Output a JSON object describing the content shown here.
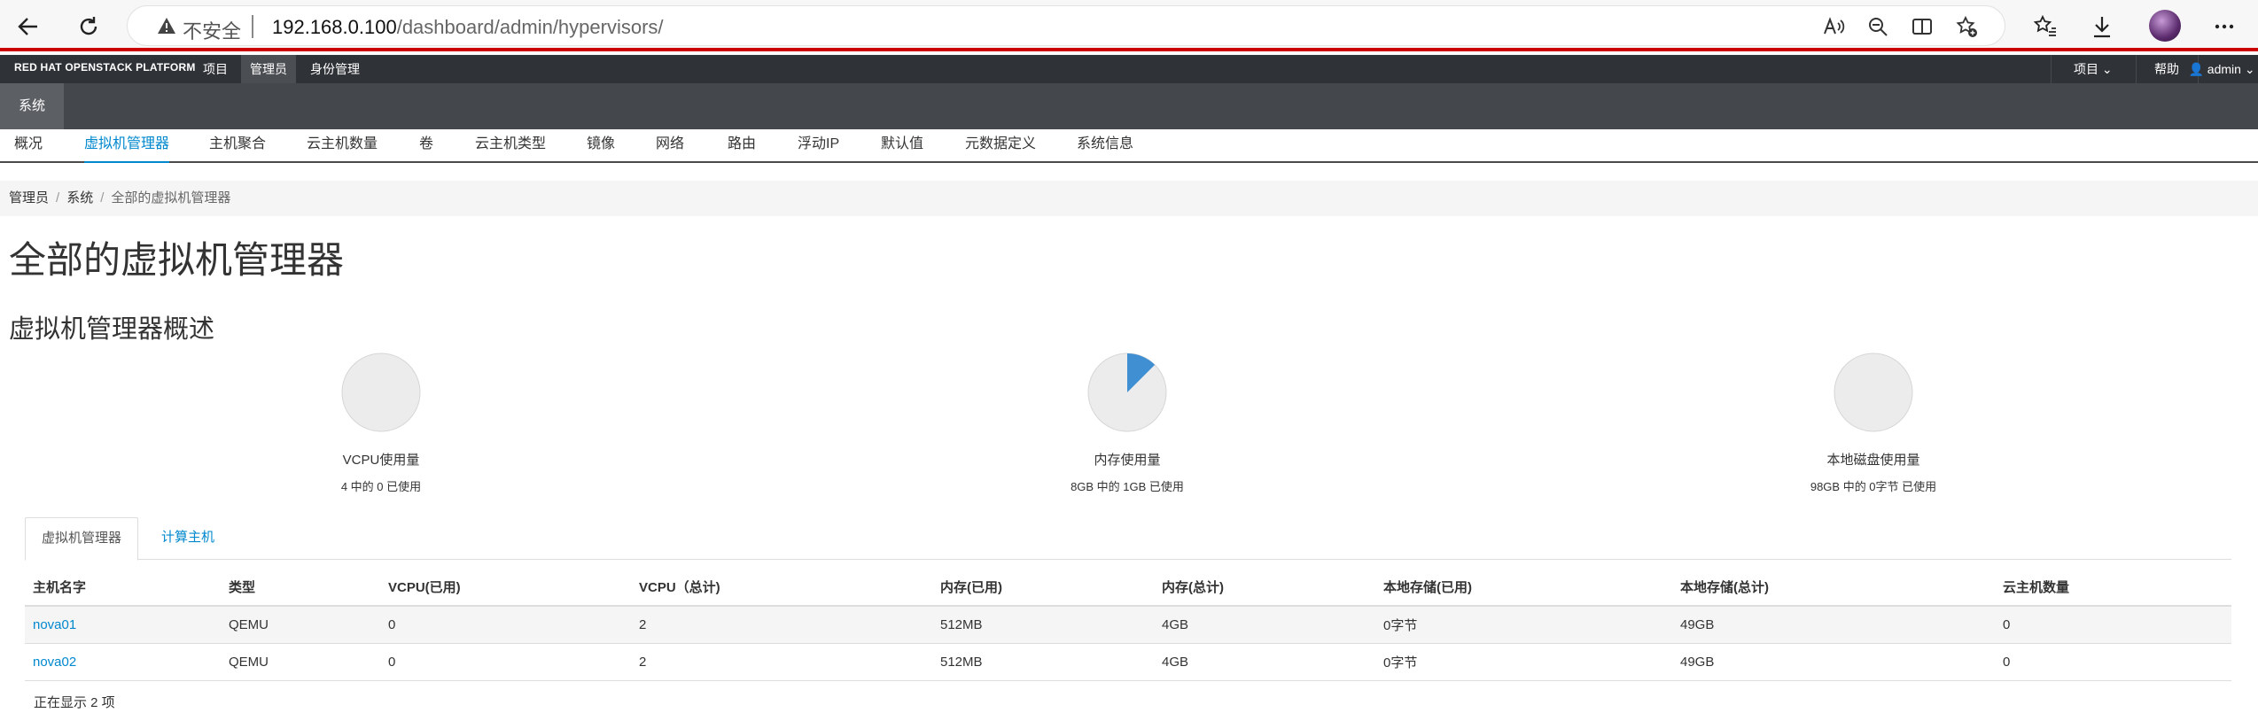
{
  "browser": {
    "insecure_label": "不安全",
    "url_host": "192.168.0.100",
    "url_path": "/dashboard/admin/hypervisors/"
  },
  "masthead": {
    "brand": "RED HAT OPENSTACK PLATFORM",
    "items": [
      "项目",
      "管理员",
      "身份管理"
    ],
    "project_menu": "项目",
    "help": "帮助",
    "user": "admin"
  },
  "second_bar": {
    "tab": "系统"
  },
  "subnav": [
    "概况",
    "虚拟机管理器",
    "主机聚合",
    "云主机数量",
    "卷",
    "云主机类型",
    "镜像",
    "网络",
    "路由",
    "浮动IP",
    "默认值",
    "元数据定义",
    "系统信息"
  ],
  "breadcrumb": [
    "管理员",
    "系统",
    "全部的虚拟机管理器"
  ],
  "page_title": "全部的虚拟机管理器",
  "section_title": "虚拟机管理器概述",
  "usage": [
    {
      "label": "VCPU使用量",
      "sub": "4 中的 0 已使用",
      "fraction": 0
    },
    {
      "label": "内存使用量",
      "sub": "8GB 中的 1GB 已使用",
      "fraction": 0.125
    },
    {
      "label": "本地磁盘使用量",
      "sub": "98GB 中的 0字节 已使用",
      "fraction": 0
    }
  ],
  "tabs": [
    "虚拟机管理器",
    "计算主机"
  ],
  "table": {
    "headers": [
      "主机名字",
      "类型",
      "VCPU(已用)",
      "VCPU（总计)",
      "内存(已用)",
      "内存(总计)",
      "本地存储(已用)",
      "本地存储(总计)",
      "云主机数量"
    ],
    "rows": [
      [
        "nova01",
        "QEMU",
        "0",
        "2",
        "512MB",
        "4GB",
        "0字节",
        "49GB",
        "0"
      ],
      [
        "nova02",
        "QEMU",
        "0",
        "2",
        "512MB",
        "4GB",
        "0字节",
        "49GB",
        "0"
      ]
    ],
    "footer": "正在显示 2 项"
  },
  "colors": {
    "accent": "#0088ce",
    "pie_fill": "#3f8fd2",
    "pie_bg": "#ececec"
  }
}
